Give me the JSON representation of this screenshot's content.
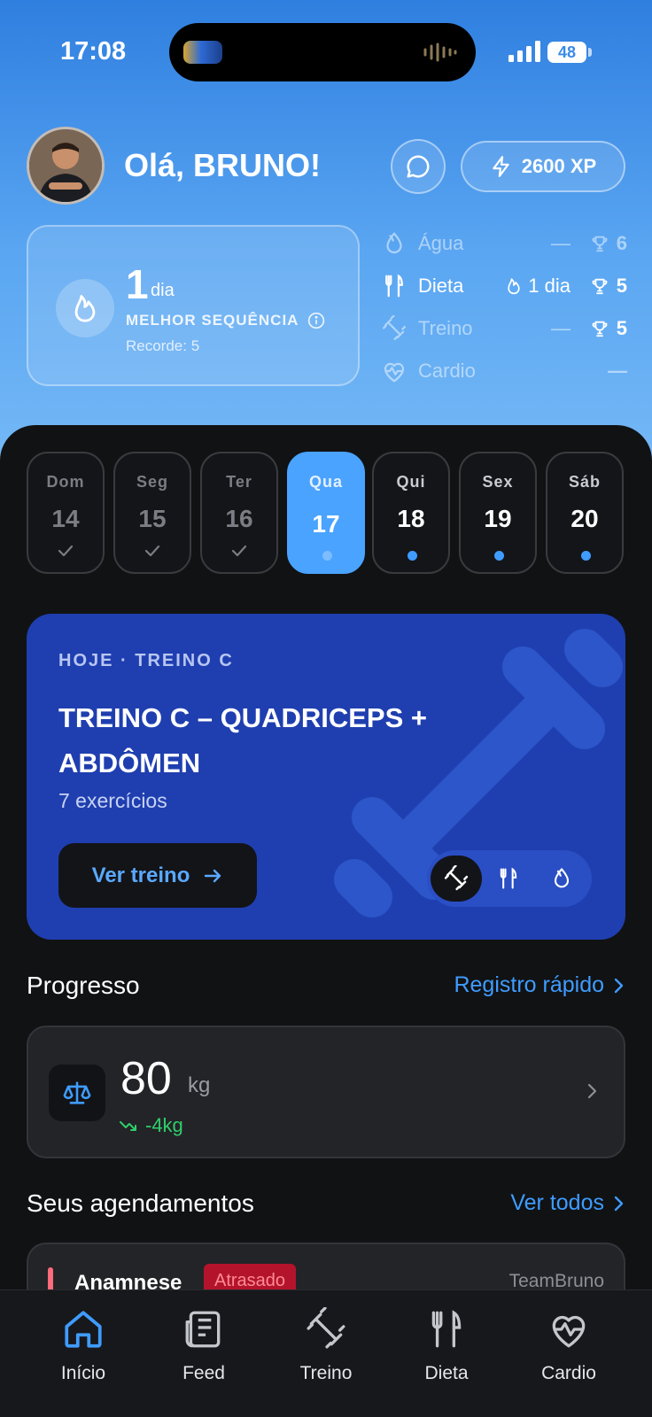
{
  "status_bar": {
    "time": "17:08",
    "battery": "48"
  },
  "header": {
    "greeting": "Olá, BRUNO!",
    "xp": "2600 XP"
  },
  "streak": {
    "value": "1",
    "unit": "dia",
    "label": "MELHOR SEQUÊNCIA",
    "record": "Recorde: 5"
  },
  "habits": [
    {
      "name": "Água",
      "streak": "—",
      "trophies": "6",
      "active": false,
      "icon": "water-drop-icon"
    },
    {
      "name": "Dieta",
      "streak": "1 dia",
      "trophies": "5",
      "active": true,
      "icon": "fork-knife-icon"
    },
    {
      "name": "Treino",
      "streak": "—",
      "trophies": "5",
      "active": false,
      "icon": "dumbbell-icon"
    },
    {
      "name": "Cardio",
      "streak": "",
      "trophies": "—",
      "active": false,
      "icon": "heart-pulse-icon"
    }
  ],
  "week": [
    {
      "name": "Dom",
      "num": "14",
      "state": "done"
    },
    {
      "name": "Seg",
      "num": "15",
      "state": "done"
    },
    {
      "name": "Ter",
      "num": "16",
      "state": "done"
    },
    {
      "name": "Qua",
      "num": "17",
      "state": "today"
    },
    {
      "name": "Qui",
      "num": "18",
      "state": "future"
    },
    {
      "name": "Sex",
      "num": "19",
      "state": "future"
    },
    {
      "name": "Sáb",
      "num": "20",
      "state": "future"
    }
  ],
  "workout": {
    "subtitle": "HOJE · TREINO C",
    "title": "TREINO C – QUADRICEPS + ABDÔMEN",
    "count": "7 exercícios",
    "button": "Ver treino"
  },
  "progress": {
    "title": "Progresso",
    "link": "Registro rápido",
    "weight": "80",
    "unit": "kg",
    "delta": "-4kg"
  },
  "appointments": {
    "title": "Seus agendamentos",
    "link": "Ver todos",
    "first": {
      "title": "Anamnese",
      "badge": "Atrasado",
      "org": "TeamBruno"
    }
  },
  "tabs": [
    {
      "label": "Início",
      "icon": "home-icon"
    },
    {
      "label": "Feed",
      "icon": "newspaper-icon"
    },
    {
      "label": "Treino",
      "icon": "dumbbell-icon"
    },
    {
      "label": "Dieta",
      "icon": "fork-knife-icon"
    },
    {
      "label": "Cardio",
      "icon": "heart-pulse-icon"
    }
  ],
  "colors": {
    "accent": "#3f9cff",
    "workout_card": "#1f3fb0",
    "positive": "#2fce6a",
    "alert": "#b3142b"
  }
}
